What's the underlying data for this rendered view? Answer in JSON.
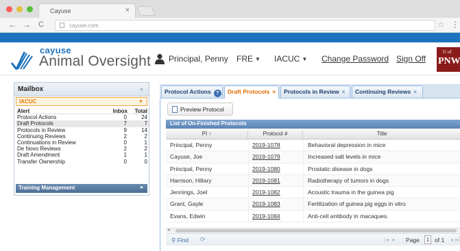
{
  "browser": {
    "tab_title": "Cayuse",
    "tab_close": "×",
    "url": "cayuse.com",
    "back_icon": "←",
    "forward_icon": "→",
    "reload_icon": "C",
    "star_icon": "☆",
    "menu_icon": "⋮"
  },
  "header": {
    "logo_sub": "cayuse",
    "logo_title": "Animal Oversight",
    "user_name": "Principal, Penny",
    "menu_fre": "FRE",
    "menu_iacuc": "IACUC",
    "caret": "▼",
    "change_password": "Change Password",
    "sign_off": "Sign Off",
    "badge_top": "U of",
    "badge_main": "PNW",
    "brand_color": "#1e73be"
  },
  "mailbox": {
    "title": "Mailbox",
    "collapse_icon": "«",
    "section": "IACUC",
    "section_arrow": "▸",
    "columns": {
      "alert": "Alert",
      "inbox": "Inbox",
      "total": "Total"
    },
    "rows": [
      {
        "name": "Protocol Actions",
        "inbox": "0",
        "total": "24"
      },
      {
        "name": "Draft Protocols",
        "inbox": "7",
        "total": "7"
      },
      {
        "name": "Protocols in Review",
        "inbox": "9",
        "total": "14"
      },
      {
        "name": "Continuing Reviews",
        "inbox": "2",
        "total": "2"
      },
      {
        "name": "Continuations in Review",
        "inbox": "0",
        "total": "1"
      },
      {
        "name": "De Novo Reviews",
        "inbox": "2",
        "total": "2"
      },
      {
        "name": "Draft Amendment",
        "inbox": "1",
        "total": "1"
      },
      {
        "name": "Transfer Ownership",
        "inbox": "0",
        "total": "0"
      }
    ],
    "training": "Training Management",
    "training_arrow": "▸"
  },
  "tabs": [
    {
      "label": "Protocol Actions",
      "help": "?"
    },
    {
      "label": "Draft Protocols",
      "close": "×"
    },
    {
      "label": "Protocols in Review",
      "close": "×"
    },
    {
      "label": "Continuing Reviews",
      "close": "×"
    }
  ],
  "grid": {
    "preview_button": "Preview Protocol",
    "title": "List of Un-Finished Protocols",
    "columns": {
      "pi": "PI ↑",
      "protocol": "Protocol #",
      "title": "Title"
    },
    "rows": [
      {
        "pi": "Principal, Penny",
        "protocol": "2019-1078",
        "title": "Behavioral depression in mice"
      },
      {
        "pi": "Cayuse, Joe",
        "protocol": "2019-1079",
        "title": "Increased salt levels in mice"
      },
      {
        "pi": "Principal, Penny",
        "protocol": "2019-1080",
        "title": "Prostatic disease in dogs"
      },
      {
        "pi": "Harrison, Hillary",
        "protocol": "2019-1081",
        "title": "Radiotherapy of tumors in dogs"
      },
      {
        "pi": "Jennings, Joel",
        "protocol": "2019-1082",
        "title": "Acoustic trauma in the guinea pig"
      },
      {
        "pi": "Grant, Gayle",
        "protocol": "2019-1083",
        "title": "Fertilization of guinea pig eggs in vitro"
      },
      {
        "pi": "Evans, Edwin",
        "protocol": "2019-1084",
        "title": "Anti-cell antibody in macaques."
      }
    ],
    "scroll_left": "◂",
    "find": "Find",
    "find_icon": "⚲",
    "refresh_icon": "⟳",
    "pager_first": "|◂ ◂",
    "page_label": "Page",
    "page_value": "1",
    "page_of": "of 1",
    "pager_next": "▸ ▸|"
  }
}
